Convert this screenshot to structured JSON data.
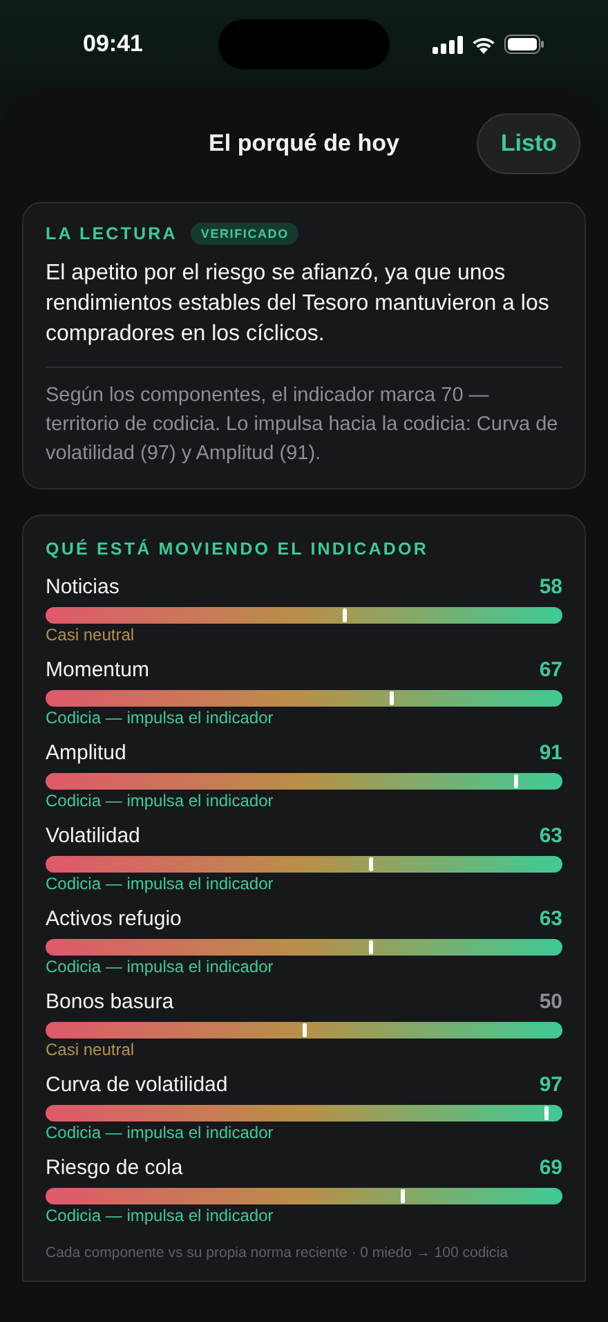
{
  "status_bar": {
    "time": "09:41"
  },
  "header": {
    "title": "El porqué de hoy",
    "done_button": "Listo"
  },
  "reading": {
    "heading": "LA LECTURA",
    "badge": "VERIFICADO",
    "summary": "El apetito por el riesgo se afianzó, ya que unos rendimientos estables del Tesoro mantuvieron a los compradores en los cíclicos.",
    "detail": "Según los componentes, el indicador marca 70 — territorio de codicia. Lo impulsa hacia la codicia: Curva de volatilidad (97) y Amplitud (91)."
  },
  "drivers": {
    "heading": "QUÉ ESTÁ MOVIENDO EL INDICADOR",
    "items": [
      {
        "name": "Noticias",
        "value": "58",
        "level": 0.58,
        "kind": "neutral",
        "note": "Casi neutral"
      },
      {
        "name": "Momentum",
        "value": "67",
        "level": 0.67,
        "kind": "greed",
        "note": "Codicia — impulsa el indicador"
      },
      {
        "name": "Amplitud",
        "value": "91",
        "level": 0.91,
        "kind": "greed",
        "note": "Codicia — impulsa el indicador"
      },
      {
        "name": "Volatilidad",
        "value": "63",
        "level": 0.63,
        "kind": "greed",
        "note": "Codicia — impulsa el indicador"
      },
      {
        "name": "Activos refugio",
        "value": "63",
        "level": 0.63,
        "kind": "greed",
        "note": "Codicia — impulsa el indicador"
      },
      {
        "name": "Bonos basura",
        "value": "50",
        "level": 0.5,
        "kind": "neutral",
        "note": "Casi neutral"
      },
      {
        "name": "Curva de volatilidad",
        "value": "97",
        "level": 0.97,
        "kind": "greed",
        "note": "Codicia — impulsa el indicador"
      },
      {
        "name": "Riesgo de cola",
        "value": "69",
        "level": 0.69,
        "kind": "greed",
        "note": "Codicia — impulsa el indicador"
      }
    ],
    "footnote": "Cada componente vs su propia norma reciente · 0 miedo → 100 codicia"
  }
}
